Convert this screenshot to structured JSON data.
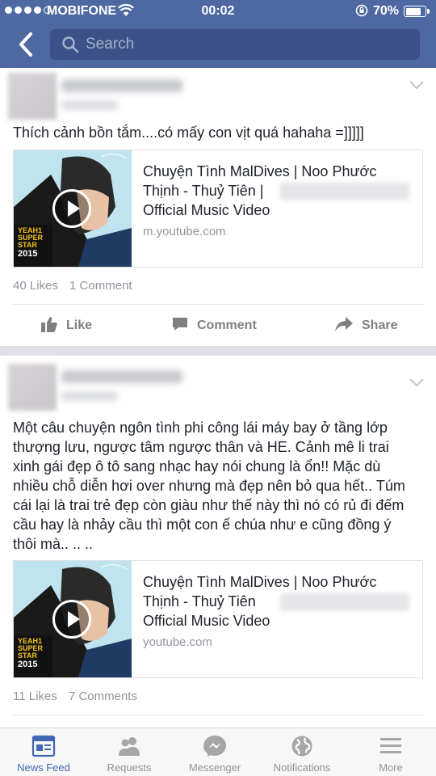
{
  "status_bar": {
    "carrier": "MOBIFONE",
    "time": "00:02",
    "battery": "70%"
  },
  "search": {
    "placeholder": "Search"
  },
  "posts": [
    {
      "text": "Thích cảnh bồn tắm....có mấy con vịt quá hahaha =]]]]]",
      "link": {
        "title_line1": "Chuyện Tình MalDives | Noo Phước",
        "title_line2": "Thịnh - Thuỷ Tiên |",
        "title_line3": "Official Music Video",
        "domain": "m.youtube.com"
      },
      "likes": "40 Likes",
      "comments": "1 Comment"
    },
    {
      "text_lines": [
        "Một câu chuyện ngôn tình phi công lái máy bay ở tầng lớp",
        "thượng lưu, ngược tâm ngược thân và HE. Cảnh mê li trai",
        "xinh gái đẹp ô tô sang nhạc hay nói chung là ổn!! Mặc dù",
        "nhiều chỗ diễn hơi over nhưng mà đẹp nên bỏ qua hết.. Túm",
        "cái lại là trai trẻ đẹp còn giàu như thế này thì nó có rủ đi đếm",
        "cầu hay là nhảy cầu thì một con ế chúa như e cũng đồng ý",
        "thôi mà.. .. .."
      ],
      "link": {
        "title_line1": "Chuyện Tình MalDives | Noo Phước",
        "title_line2": "Thịnh - Thuỷ Tiên",
        "title_line3": "Official Music Video",
        "domain": "youtube.com"
      },
      "likes": "11 Likes",
      "comments": "7 Comments"
    }
  ],
  "actions": {
    "like": "Like",
    "comment": "Comment",
    "share": "Share"
  },
  "thumbnail": {
    "line1": "YEAH1",
    "line2": "SUPER",
    "line3": "STAR",
    "year": "2015"
  },
  "tabs": [
    {
      "label": "News Feed",
      "icon": "news-feed-icon"
    },
    {
      "label": "Requests",
      "icon": "friend-requests-icon"
    },
    {
      "label": "Messenger",
      "icon": "messenger-icon"
    },
    {
      "label": "Notifications",
      "icon": "globe-icon"
    },
    {
      "label": "More",
      "icon": "menu-icon"
    }
  ],
  "colors": {
    "header": "#4e69a2",
    "active_tab": "#4267b2",
    "muted": "#90949c"
  }
}
